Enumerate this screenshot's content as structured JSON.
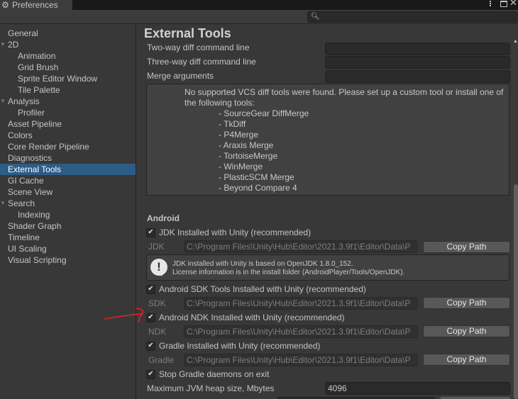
{
  "window": {
    "title": "Preferences",
    "icon": "gear-icon",
    "controls": [
      "more-options",
      "maximize",
      "close"
    ]
  },
  "toolbar": {
    "search_placeholder": "",
    "search_icon": "search-icon"
  },
  "sidebar": {
    "items": [
      {
        "label": "General",
        "level": 0,
        "expandable": false
      },
      {
        "label": "2D",
        "level": 0,
        "expandable": true,
        "expanded": true
      },
      {
        "label": "Animation",
        "level": 1
      },
      {
        "label": "Grid Brush",
        "level": 1
      },
      {
        "label": "Sprite Editor Window",
        "level": 1
      },
      {
        "label": "Tile Palette",
        "level": 1
      },
      {
        "label": "Analysis",
        "level": 0,
        "expandable": true,
        "expanded": true
      },
      {
        "label": "Profiler",
        "level": 1
      },
      {
        "label": "Asset Pipeline",
        "level": 0
      },
      {
        "label": "Colors",
        "level": 0
      },
      {
        "label": "Core Render Pipeline",
        "level": 0
      },
      {
        "label": "Diagnostics",
        "level": 0
      },
      {
        "label": "External Tools",
        "level": 0,
        "selected": true
      },
      {
        "label": "GI Cache",
        "level": 0
      },
      {
        "label": "Scene View",
        "level": 0
      },
      {
        "label": "Search",
        "level": 0,
        "expandable": true,
        "expanded": true
      },
      {
        "label": "Indexing",
        "level": 1
      },
      {
        "label": "Shader Graph",
        "level": 0
      },
      {
        "label": "Timeline",
        "level": 0
      },
      {
        "label": "UI Scaling",
        "level": 0
      },
      {
        "label": "Visual Scripting",
        "level": 0
      }
    ],
    "selected_color": "#2c5d87"
  },
  "main": {
    "title": "External Tools",
    "diff_fields": [
      {
        "label": "Two-way diff command line",
        "value": ""
      },
      {
        "label": "Three-way diff command line",
        "value": ""
      },
      {
        "label": "Merge arguments",
        "value": ""
      }
    ],
    "vcs_help": {
      "message": "No supported VCS diff tools were found. Please set up a custom tool or install one of the following tools:",
      "tools": [
        "- SourceGear DiffMerge",
        "- TkDiff",
        "- P4Merge",
        "- Araxis Merge",
        "- TortoiseMerge",
        "- WinMerge",
        "- PlasticSCM Merge",
        "- Beyond Compare 4"
      ]
    },
    "android": {
      "section_title": "Android",
      "jdk": {
        "checkbox_label": "JDK Installed with Unity (recommended)",
        "checked": true,
        "path_label": "JDK",
        "path": "C:\\Program Files\\Unity\\Hub\\Editor\\2021.3.9f1\\Editor\\Data\\P",
        "copy_label": "Copy Path"
      },
      "jdk_info": {
        "line1": "JDK installed with Unity is based on OpenJDK 1.8.0_152.",
        "line2": "License information is in the install folder (AndroidPlayer/Tools/OpenJDK).",
        "icon": "info-bubble-icon"
      },
      "sdk": {
        "checkbox_label": "Android SDK Tools Installed with Unity (recommended)",
        "checked": true,
        "path_label": "SDK",
        "path": "C:\\Program Files\\Unity\\Hub\\Editor\\2021.3.9f1\\Editor\\Data\\P",
        "copy_label": "Copy Path"
      },
      "ndk": {
        "checkbox_label": "Android NDK Installed with Unity (recommended)",
        "checked": true,
        "path_label": "NDK",
        "path": "C:\\Program Files\\Unity\\Hub\\Editor\\2021.3.9f1\\Editor\\Data\\P",
        "copy_label": "Copy Path"
      },
      "gradle": {
        "checkbox_label": "Gradle Installed with Unity (recommended)",
        "checked": true,
        "path_label": "Gradle",
        "path": "C:\\Program Files\\Unity\\Hub\\Editor\\2021.3.9f1\\Editor\\Data\\P",
        "copy_label": "Copy Path"
      },
      "stop_gradle": {
        "checkbox_label": "Stop Gradle daemons on exit",
        "checked": true
      },
      "jvm_heap": {
        "label": "Maximum JVM heap size, Mbytes",
        "value": "4096"
      }
    }
  },
  "annotation": {
    "type": "red-arrow",
    "color": "#e8202a",
    "points_to": "Android NDK Installed with Unity (recommended)"
  }
}
